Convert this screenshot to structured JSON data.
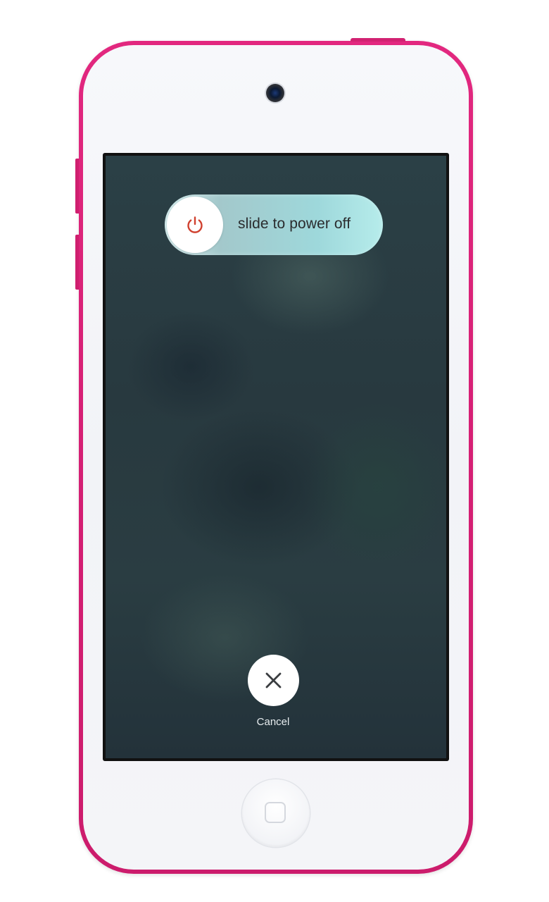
{
  "device": {
    "color": "#d9237a",
    "screen_state": "power-off-prompt"
  },
  "power_slider": {
    "label": "slide to power off",
    "icon": "power-icon",
    "icon_color": "#d0412f"
  },
  "cancel": {
    "label": "Cancel",
    "icon": "close-icon"
  },
  "home_button": {
    "icon": "home-square-icon"
  }
}
